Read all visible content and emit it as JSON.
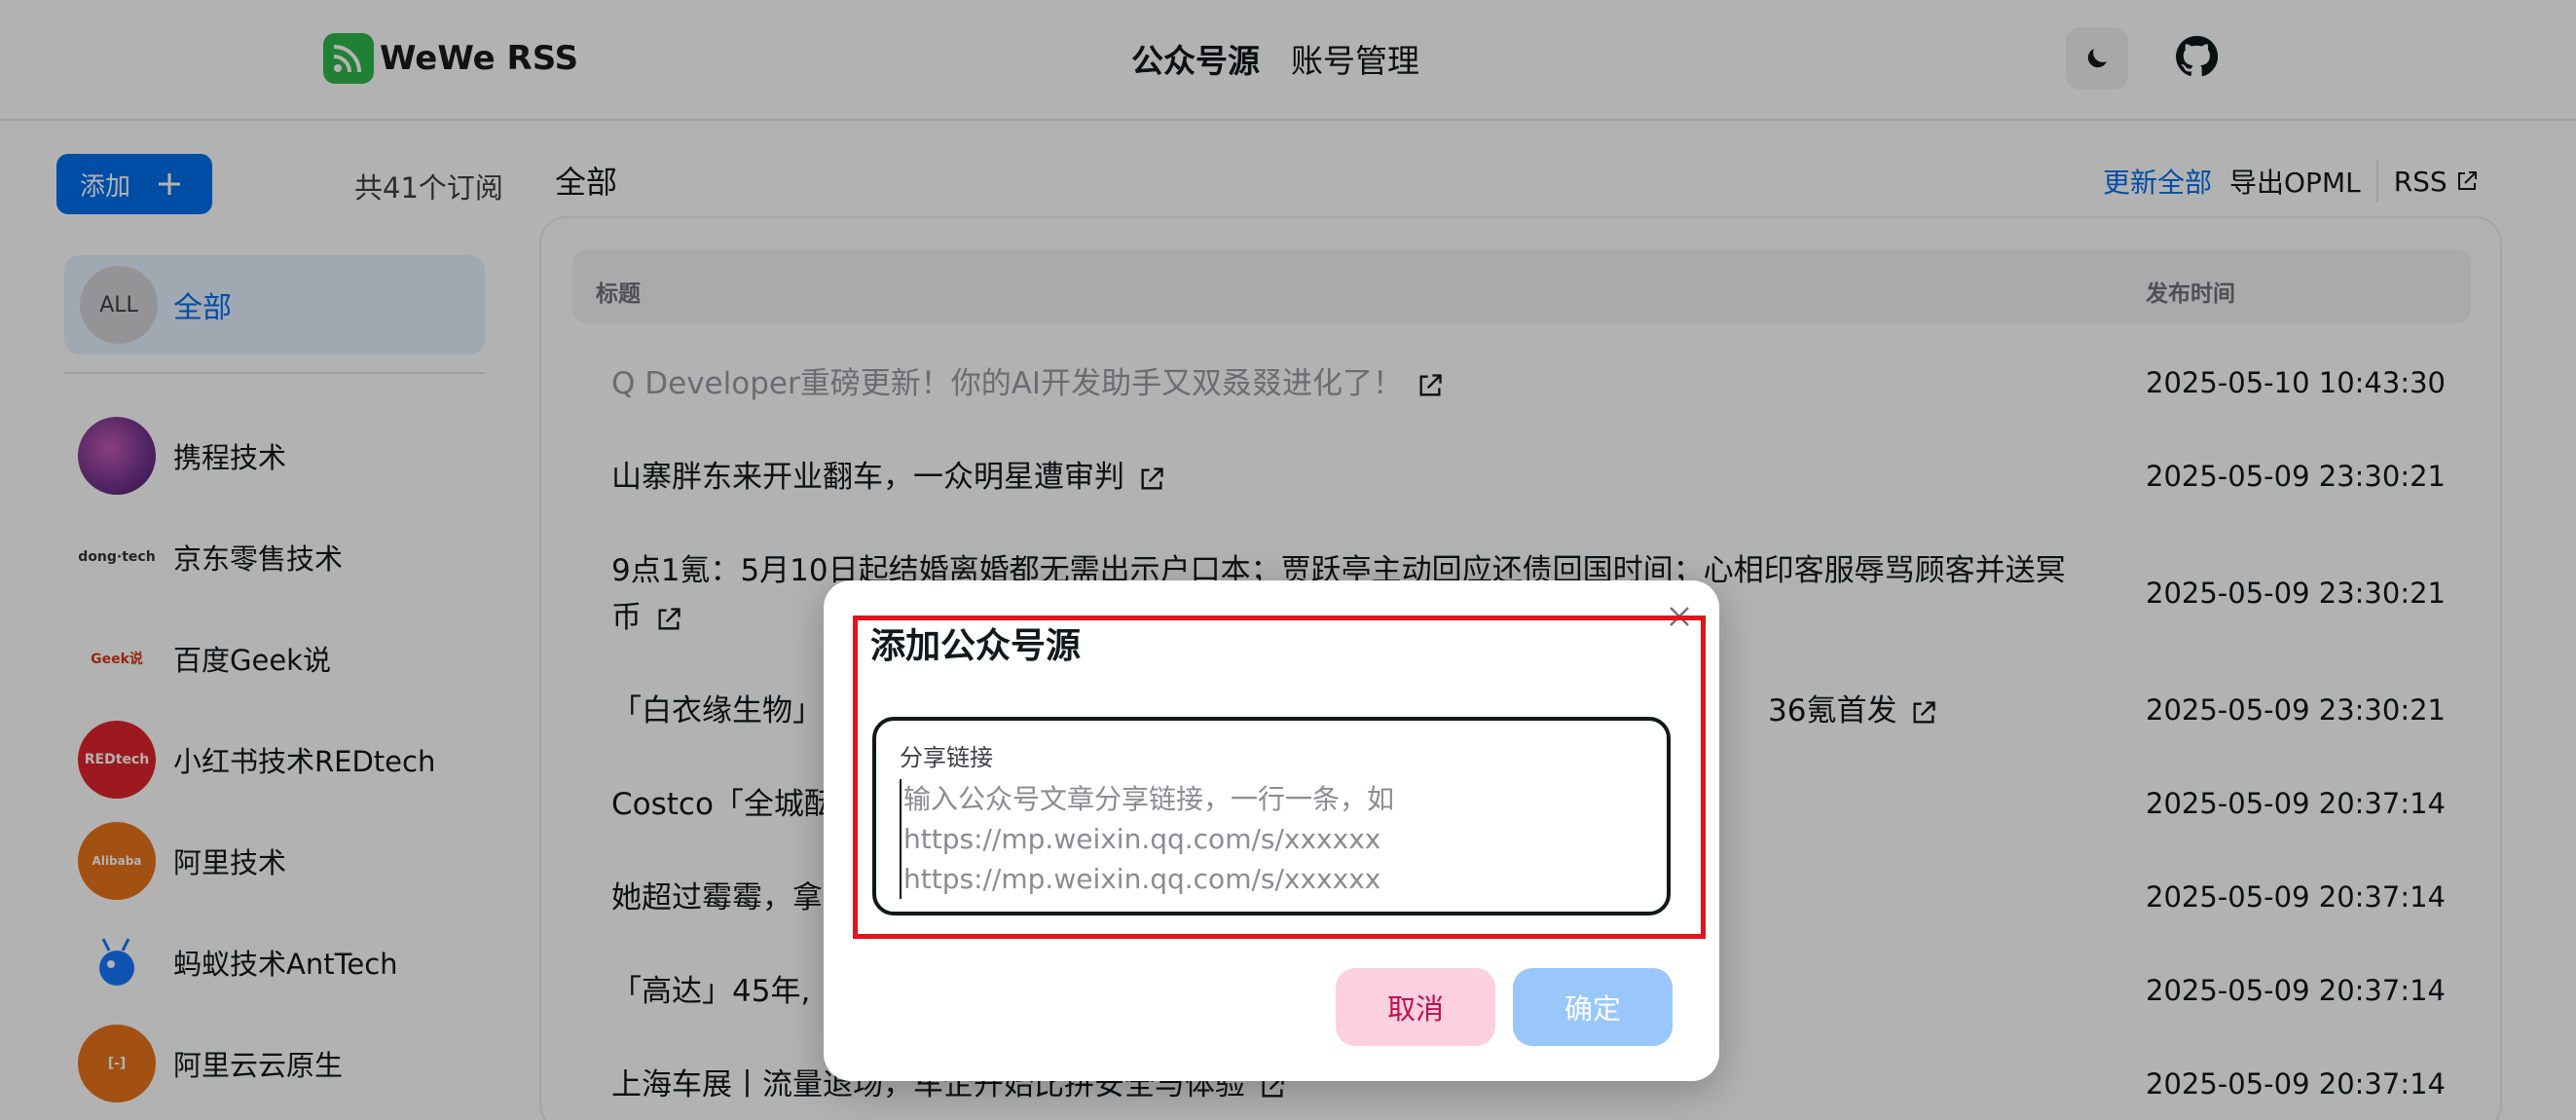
{
  "header": {
    "app_name": "WeWe RSS",
    "nav": [
      {
        "label": "公众号源",
        "active": true
      },
      {
        "label": "账号管理",
        "active": false
      }
    ],
    "icons": {
      "logo": "rss-logo-icon",
      "theme": "moon-icon",
      "github": "github-icon"
    }
  },
  "sidebar": {
    "add_label": "添加",
    "subscription_count": "共41个订阅",
    "all": {
      "avatar_text": "ALL",
      "label": "全部"
    },
    "feeds": [
      {
        "name": "携程技术",
        "color": "#6a2c8e"
      },
      {
        "name": "京东零售技术",
        "color": "#ffffff"
      },
      {
        "name": "百度Geek说",
        "color": "#ffffff"
      },
      {
        "name": "小红书技术REDtech",
        "color": "#e0262d"
      },
      {
        "name": "阿里技术",
        "color": "#e8751a"
      },
      {
        "name": "蚂蚁技术AntTech",
        "color": "#ffffff"
      },
      {
        "name": "阿里云云原生",
        "color": "#e8751a"
      }
    ]
  },
  "main": {
    "title": "全部",
    "actions": {
      "update_all": "更新全部",
      "export_opml": "导出OPML",
      "rss": "RSS"
    },
    "table": {
      "headers": {
        "title": "标题",
        "date": "发布时间"
      },
      "rows": [
        {
          "title": "Q Developer重磅更新！你的AI开发助手又双叒叕进化了！",
          "date": "2025-05-10 10:43:30",
          "read": true
        },
        {
          "title": "山寨胖东来开业翻车，一众明星遭审判",
          "date": "2025-05-09 23:30:21",
          "read": false
        },
        {
          "title": "9点1氪：5月10日起结婚离婚都无需出示户口本；贾跃亭主动回应还债回国时间；心相印客服辱骂顾客并送冥币",
          "date": "2025-05-09 23:30:21",
          "read": false
        },
        {
          "title": "「白衣缘生物」",
          "title_tail": "36氪首发",
          "date": "2025-05-09 23:30:21",
          "read": false
        },
        {
          "title": "Costco「全城酝",
          "date": "2025-05-09 20:37:14",
          "read": false
        },
        {
          "title": "她超过霉霉，拿",
          "date": "2025-05-09 20:37:14",
          "read": false
        },
        {
          "title": "「高达」45年,",
          "date": "2025-05-09 20:37:14",
          "read": false
        },
        {
          "title": "上海车展丨流量退场，车企开始比拼安全与体验",
          "date": "2025-05-09 20:37:14",
          "read": false
        }
      ]
    }
  },
  "modal": {
    "title": "添加公众号源",
    "field_label": "分享链接",
    "placeholder": "输入公众号文章分享链接，一行一条，如\nhttps://mp.weixin.qq.com/s/xxxxxx\nhttps://mp.weixin.qq.com/s/xxxxxx",
    "cancel_label": "取消",
    "confirm_label": "确定",
    "highlight_color": "#e3131b"
  }
}
